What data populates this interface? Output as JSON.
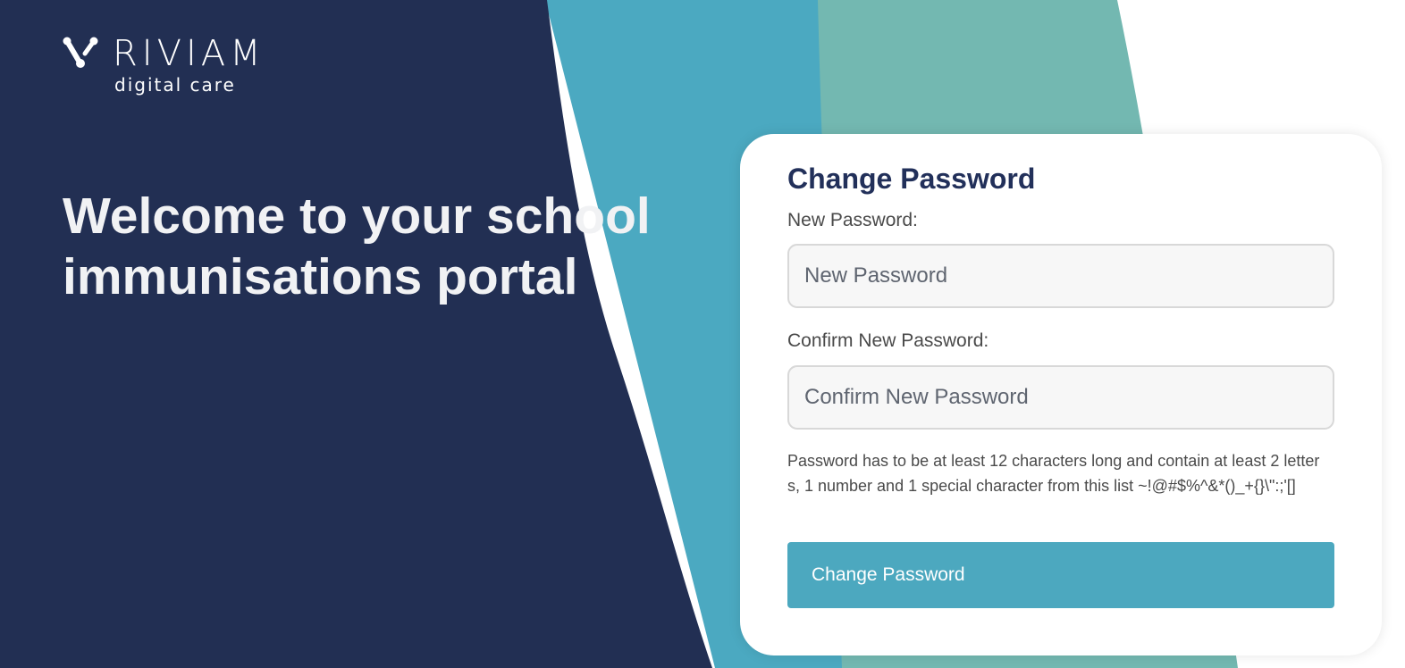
{
  "brand": {
    "name": "RIVIAM",
    "tagline": "digital care",
    "logo_icon": "riviam-mark-icon"
  },
  "hero": {
    "title": "Welcome to your school immunisations portal"
  },
  "form": {
    "title": "Change Password",
    "new_password": {
      "label": "New Password:",
      "placeholder": "New Password",
      "value": ""
    },
    "confirm_password": {
      "label": "Confirm New Password:",
      "placeholder": "Confirm New Password",
      "value": ""
    },
    "hint": "Password has to be at least 12 characters long and contain at least 2 letters, 1 number and 1 special character from this list ~!@#$%^&*()_+{}\\\":;'[]",
    "submit_label": "Change Password"
  },
  "colors": {
    "navy": "#222f53",
    "blue": "#4ba9c1",
    "teal": "#73b8b1",
    "button": "#4ca8bf",
    "title": "#22305a"
  }
}
